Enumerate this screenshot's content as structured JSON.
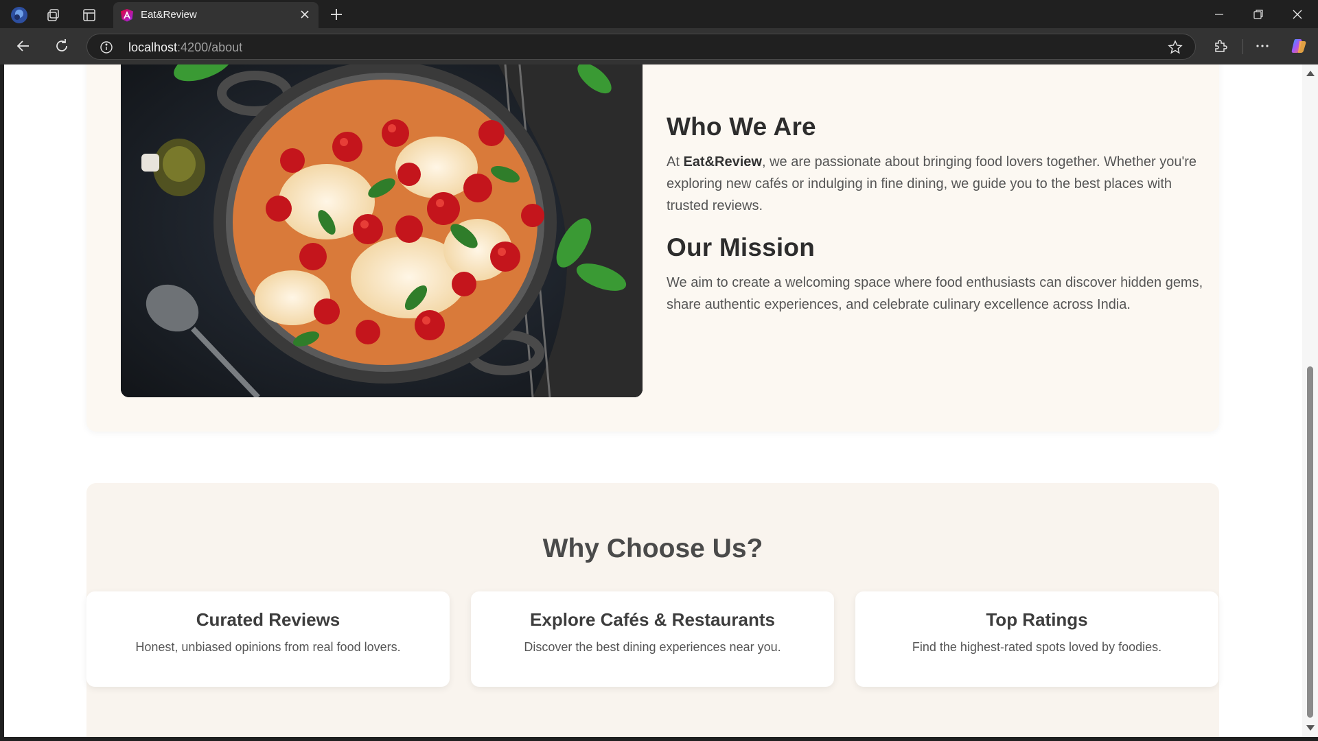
{
  "browser": {
    "tab_title": "Eat&Review",
    "url_host": "localhost",
    "url_path": ":4200/about"
  },
  "about": {
    "who_heading": "Who We Are",
    "who_prefix": "At ",
    "who_brand": "Eat&Review",
    "who_body": ", we are passionate about bringing food lovers together. Whether you're exploring new cafés or indulging in fine dining, we guide you to the best places with trusted reviews.",
    "mission_heading": "Our Mission",
    "mission_body": "We aim to create a welcoming space where food enthusiasts can discover hidden gems, share authentic experiences, and celebrate culinary excellence across India."
  },
  "why": {
    "title": "Why Choose Us?",
    "features": [
      {
        "title": "Curated Reviews",
        "desc": "Honest, unbiased opinions from real food lovers."
      },
      {
        "title": "Explore Cafés & Restaurants",
        "desc": "Discover the best dining experiences near you."
      },
      {
        "title": "Top Ratings",
        "desc": "Find the highest-rated spots loved by foodies."
      }
    ]
  },
  "colors": {
    "about_bg": "#fcf8f2",
    "why_bg": "#f9f4ee",
    "heading": "#2d2d2d",
    "body_text": "#555555"
  }
}
